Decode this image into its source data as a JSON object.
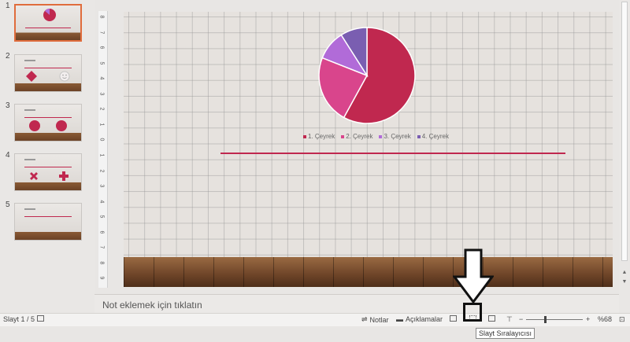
{
  "thumbnails": [
    {
      "number": "1",
      "selected": true
    },
    {
      "number": "2",
      "selected": false
    },
    {
      "number": "3",
      "selected": false
    },
    {
      "number": "4",
      "selected": false
    },
    {
      "number": "5",
      "selected": false
    }
  ],
  "ruler": {
    "marks": [
      "8",
      "7",
      "6",
      "5",
      "4",
      "3",
      "2",
      "1",
      "0",
      "1",
      "2",
      "3",
      "4",
      "5",
      "6",
      "7",
      "8",
      "9"
    ]
  },
  "slide": {
    "chart_data": {
      "type": "pie",
      "categories": [
        "1. Çeyrek",
        "2. Çeyrek",
        "3. Çeyrek",
        "4. Çeyrek"
      ],
      "values": [
        58,
        23,
        10,
        9
      ],
      "colors": [
        "#c0284f",
        "#d9458c",
        "#b16bd8",
        "#7a5eb1"
      ]
    }
  },
  "notes": {
    "placeholder": "Not eklemek için tıklatın"
  },
  "status": {
    "slide_info": "Slayt 1 / 5",
    "notes_label": "Notlar",
    "comments_label": "Açıklamalar",
    "zoom": "%68",
    "zoom_level": 0.68
  },
  "tooltip": {
    "text": "Slayt Sıralayıcısı"
  },
  "colors": {
    "accent": "#c0284f",
    "selection": "#e06c3c"
  }
}
